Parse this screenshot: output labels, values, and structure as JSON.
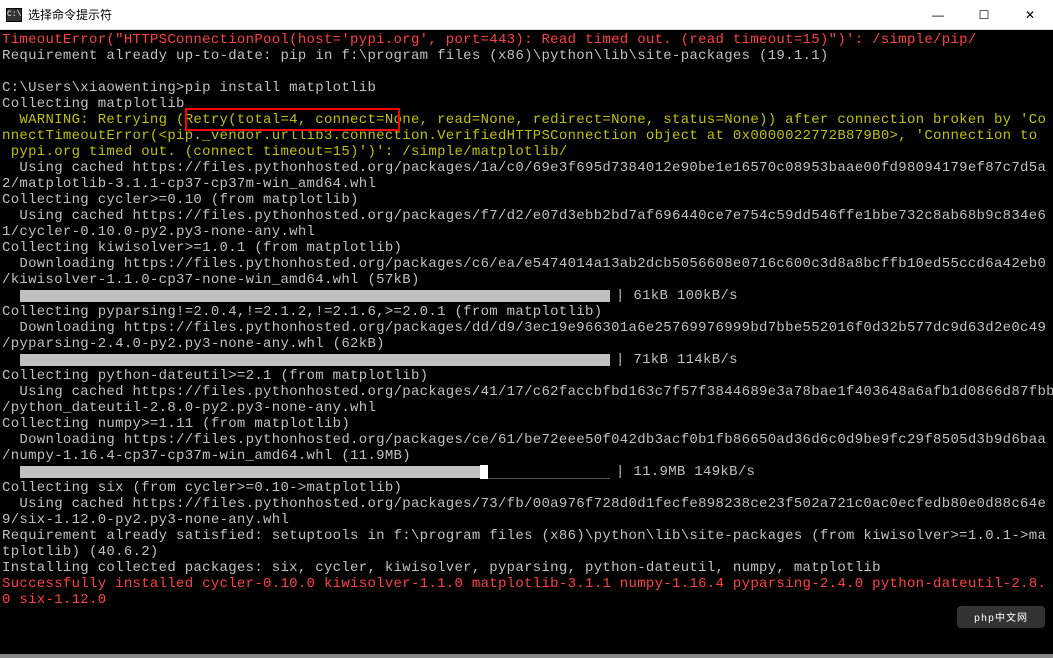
{
  "window": {
    "title": "选择命令提示符"
  },
  "icons": {
    "min": "—",
    "max": "☐",
    "close": "✕"
  },
  "lines": {
    "l1a": "TimeoutError(\"HTTPSConnectionPool(host='pypi.org', port=443): Read timed out. (read timeout=15)\")': /simple/pip/",
    "l2a": "Requirement already up-to-date: pip in f:\\program files (x86)\\python\\lib\\site-packages (19.1.1)",
    "blank": "",
    "prompt": "C:\\Users\\xiaowenting>",
    "cmd": "pip install matplotlib",
    "l5": "Collecting matplotlib",
    "warnA": "  WARNING: Retrying (Retry(total=4, connect=None, read=None, redirect=None, status=None)) after connection broken by 'Co",
    "warnB": "nnectTimeoutError(<pip._vendor.urllib3.connection.VerifiedHTTPSConnection object at 0x0000022772B879B0>, 'Connection to",
    "warnC": " pypi.org timed out. (connect timeout=15)')': /simple/matplotlib/",
    "l9a": "  Using cached https://files.pythonhosted.org/packages/1a/c0/69e3f695d7384012e90be1e16570c08953baae00fd98094179ef87c7d5a",
    "l9b": "2/matplotlib-3.1.1-cp37-cp37m-win_amd64.whl",
    "l10": "Collecting cycler>=0.10 (from matplotlib)",
    "l11a": "  Using cached https://files.pythonhosted.org/packages/f7/d2/e07d3ebb2bd7af696440ce7e754c59dd546ffe1bbe732c8ab68b9c834e6",
    "l11b": "1/cycler-0.10.0-py2.py3-none-any.whl",
    "l12": "Collecting kiwisolver>=1.0.1 (from matplotlib)",
    "l13a": "  Downloading https://files.pythonhosted.org/packages/c6/ea/e5474014a13ab2dcb5056608e0716c600c3d8a8bcffb10ed55ccd6a42eb0",
    "l13b": "/kiwisolver-1.1.0-cp37-none-win_amd64.whl (57kB)",
    "p1": "| 61kB 100kB/s",
    "l15": "Collecting pyparsing!=2.0.4,!=2.1.2,!=2.1.6,>=2.0.1 (from matplotlib)",
    "l16a": "  Downloading https://files.pythonhosted.org/packages/dd/d9/3ec19e966301a6e25769976999bd7bbe552016f0d32b577dc9d63d2e0c49",
    "l16b": "/pyparsing-2.4.0-py2.py3-none-any.whl (62kB)",
    "p2": "| 71kB 114kB/s",
    "l18": "Collecting python-dateutil>=2.1 (from matplotlib)",
    "l19a": "  Using cached https://files.pythonhosted.org/packages/41/17/c62faccbfbd163c7f57f3844689e3a78bae1f403648a6afb1d0866d87fbb",
    "l19b": "/python_dateutil-2.8.0-py2.py3-none-any.whl",
    "l20": "Collecting numpy>=1.11 (from matplotlib)",
    "l21a": "  Downloading https://files.pythonhosted.org/packages/ce/61/be72eee50f042db3acf0b1fb86650ad36d6c0d9be9fc29f8505d3b9d6baa",
    "l21b": "/numpy-1.16.4-cp37-cp37m-win_amd64.whl (11.9MB)",
    "p3": "| 11.9MB 149kB/s",
    "l23": "Collecting six (from cycler>=0.10->matplotlib)",
    "l24a": "  Using cached https://files.pythonhosted.org/packages/73/fb/00a976f728d0d1fecfe898238ce23f502a721c0ac0ecfedb80e0d88c64e",
    "l24b": "9/six-1.12.0-py2.py3-none-any.whl",
    "l25a": "Requirement already satisfied: setuptools in f:\\program files (x86)\\python\\lib\\site-packages (from kiwisolver>=1.0.1->ma",
    "l25b": "tplotlib) (40.6.2)",
    "l26": "Installing collected packages: six, cycler, kiwisolver, pyparsing, python-dateutil, numpy, matplotlib",
    "l27a": "Successfully installed cycler-0.10.0 kiwisolver-1.1.0 matplotlib-3.1.1 numpy-1.16.4 pyparsing-2.4.0 python-dateutil-2.8.",
    "l27b": "0 six-1.12.0"
  },
  "watermark": "php中文网"
}
